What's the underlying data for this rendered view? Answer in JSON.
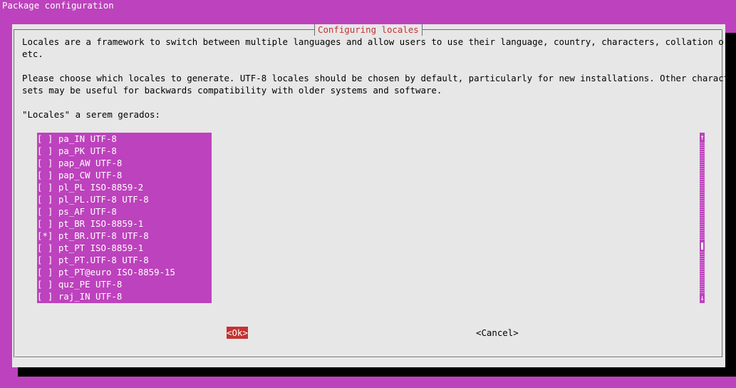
{
  "screen": {
    "title": "Package configuration"
  },
  "dialog": {
    "title": "Configuring locales",
    "description_lines": [
      "Locales are a framework to switch between multiple languages and allow users to use their language, country, characters, collation order,",
      "etc.",
      "",
      "Please choose which locales to generate. UTF-8 locales should be chosen by default, particularly for new installations. Other character",
      "sets may be useful for backwards compatibility with older systems and software.",
      "",
      "\"Locales\" a serem gerados:"
    ],
    "locales": [
      {
        "label": "[ ] pa_IN UTF-8",
        "checked": false
      },
      {
        "label": "[ ] pa_PK UTF-8",
        "checked": false
      },
      {
        "label": "[ ] pap_AW UTF-8",
        "checked": false
      },
      {
        "label": "[ ] pap_CW UTF-8",
        "checked": false
      },
      {
        "label": "[ ] pl_PL ISO-8859-2",
        "checked": false
      },
      {
        "label": "[ ] pl_PL.UTF-8 UTF-8",
        "checked": false
      },
      {
        "label": "[ ] ps_AF UTF-8",
        "checked": false
      },
      {
        "label": "[ ] pt_BR ISO-8859-1",
        "checked": false
      },
      {
        "label": "[*] pt_BR.UTF-8 UTF-8",
        "checked": true
      },
      {
        "label": "[ ] pt_PT ISO-8859-1",
        "checked": false
      },
      {
        "label": "[ ] pt_PT.UTF-8 UTF-8",
        "checked": false
      },
      {
        "label": "[ ] pt_PT@euro ISO-8859-15",
        "checked": false
      },
      {
        "label": "[ ] quz_PE UTF-8",
        "checked": false
      },
      {
        "label": "[ ] raj_IN UTF-8",
        "checked": false
      }
    ],
    "scrollbar": {
      "up_arrow": "↑",
      "down_arrow": "↓",
      "position": 0.7
    },
    "buttons": {
      "ok_label": "<Ok>",
      "cancel_label": "<Cancel>"
    }
  },
  "colors": {
    "background": "#bd42bd",
    "dialog": "#e7e7e7",
    "title": "#c43232",
    "selected_button": "#c43232"
  }
}
